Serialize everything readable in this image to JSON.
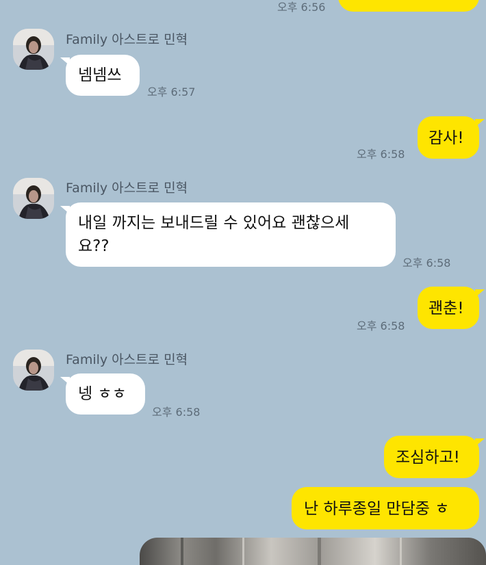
{
  "colors": {
    "background": "#abc1d1",
    "incoming_bubble": "#ffffff",
    "outgoing_bubble": "#fee500",
    "timestamp": "#5d6c79",
    "sender_name": "#4a5663"
  },
  "messages": [
    {
      "direction": "outgoing",
      "text": "",
      "time": "오후 6:56"
    },
    {
      "direction": "incoming",
      "sender": "Family 아스트로 민혁",
      "avatar_icon": "profile-photo",
      "text": "넴넴쓰",
      "time": "오후 6:57"
    },
    {
      "direction": "outgoing",
      "text": "감사!",
      "time": "오후 6:58"
    },
    {
      "direction": "incoming",
      "sender": "Family 아스트로 민혁",
      "avatar_icon": "profile-photo",
      "text_line1": "내일 까지는 보내드릴 수 있어요 괜찮으세",
      "text_line2": "요??",
      "time": "오후 6:58"
    },
    {
      "direction": "outgoing",
      "text": "괜춘!",
      "time": "오후 6:58"
    },
    {
      "direction": "incoming",
      "sender": "Family 아스트로 민혁",
      "avatar_icon": "profile-photo",
      "text": "넹 ㅎㅎ",
      "time": "오후 6:58"
    },
    {
      "direction": "outgoing",
      "text": "조심하고!"
    },
    {
      "direction": "outgoing",
      "text": "난 하루종일 만담중 ㅎ"
    },
    {
      "direction": "outgoing",
      "type": "image",
      "icon": "photo-attachment"
    }
  ]
}
